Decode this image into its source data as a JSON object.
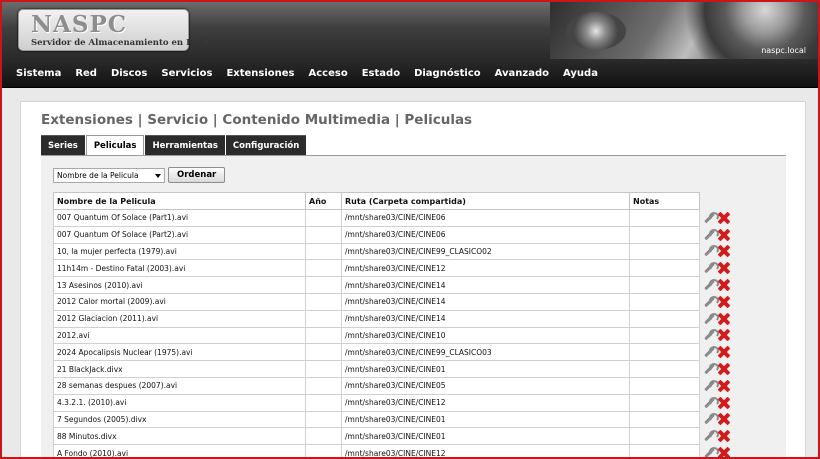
{
  "header": {
    "logo_title": "NASPC",
    "logo_subtitle": "Servidor de Almacenamiento en Red",
    "hostname": "naspc.local"
  },
  "nav": [
    "Sistema",
    "Red",
    "Discos",
    "Servicios",
    "Extensiones",
    "Acceso",
    "Estado",
    "Diagnóstico",
    "Avanzado",
    "Ayuda"
  ],
  "page_title": "Extensiones | Servicio | Contenido Multimedia | Peliculas",
  "tabs": [
    {
      "label": "Series",
      "active": false
    },
    {
      "label": "Peliculas",
      "active": true
    },
    {
      "label": "Herramientas",
      "active": false
    },
    {
      "label": "Configuración",
      "active": false
    }
  ],
  "sort": {
    "selected": "Nombre de la Pelicula",
    "button_label": "Ordenar"
  },
  "table": {
    "headers": [
      "Nombre de la Pelicula",
      "Año",
      "Ruta (Carpeta compartida)",
      "Notas"
    ],
    "rows": [
      [
        "007 Quantum Of Solace (Part1).avi",
        "",
        "/mnt/share03/CINE/CINE06",
        ""
      ],
      [
        "007 Quantum Of Solace (Part2).avi",
        "",
        "/mnt/share03/CINE/CINE06",
        ""
      ],
      [
        "10, la mujer perfecta (1979).avi",
        "",
        "/mnt/share03/CINE/CINE99_CLASICO02",
        ""
      ],
      [
        "11h14m - Destino Fatal (2003).avi",
        "",
        "/mnt/share03/CINE/CINE12",
        ""
      ],
      [
        "13 Asesinos (2010).avi",
        "",
        "/mnt/share03/CINE/CINE14",
        ""
      ],
      [
        "2012 Calor mortal (2009).avi",
        "",
        "/mnt/share03/CINE/CINE14",
        ""
      ],
      [
        "2012 Glaciacion (2011).avi",
        "",
        "/mnt/share03/CINE/CINE14",
        ""
      ],
      [
        "2012.avi",
        "",
        "/mnt/share03/CINE/CINE10",
        ""
      ],
      [
        "2024 Apocalipsis Nuclear (1975).avi",
        "",
        "/mnt/share03/CINE/CINE99_CLASICO03",
        ""
      ],
      [
        "21 BlackJack.divx",
        "",
        "/mnt/share03/CINE/CINE01",
        ""
      ],
      [
        "28 semanas despues (2007).avi",
        "",
        "/mnt/share03/CINE/CINE05",
        ""
      ],
      [
        "4.3.2.1. (2010).avi",
        "",
        "/mnt/share03/CINE/CINE12",
        ""
      ],
      [
        "7 Segundos (2005).divx",
        "",
        "/mnt/share03/CINE/CINE01",
        ""
      ],
      [
        "88 Minutos.divx",
        "",
        "/mnt/share03/CINE/CINE01",
        ""
      ],
      [
        "A Fondo (2010).avi",
        "",
        "/mnt/share03/CINE/CINE12",
        ""
      ]
    ]
  },
  "row_actions": {
    "edit_icon": "wrench-icon",
    "delete_icon": "delete-x-icon"
  },
  "colors": {
    "frame": "#c8161b",
    "nav_bg": "#1a1a1a",
    "delete": "#d21b1b"
  }
}
